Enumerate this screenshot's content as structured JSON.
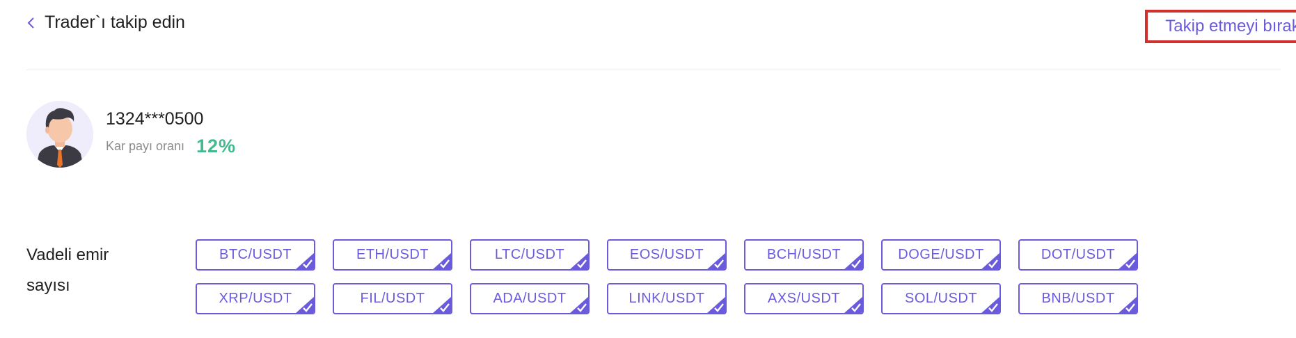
{
  "header": {
    "back_title": "Trader`ı takip edin",
    "unfollow_label": "Takip etmeyi bırak"
  },
  "profile": {
    "username": "1324***0500",
    "rate_label": "Kar payı oranı",
    "rate_value": "12%"
  },
  "section": {
    "label_line1": "Vadeli emir",
    "label_line2": "sayısı"
  },
  "pairs": [
    "BTC/USDT",
    "ETH/USDT",
    "LTC/USDT",
    "EOS/USDT",
    "BCH/USDT",
    "DOGE/USDT",
    "DOT/USDT",
    "XRP/USDT",
    "FIL/USDT",
    "ADA/USDT",
    "LINK/USDT",
    "AXS/USDT",
    "SOL/USDT",
    "BNB/USDT"
  ],
  "colors": {
    "accent": "#6a5bdc",
    "rate": "#44b98e",
    "highlight_border": "#d0312d"
  },
  "icons": {
    "back": "chevron-left-icon",
    "selected": "checkmark-icon"
  }
}
